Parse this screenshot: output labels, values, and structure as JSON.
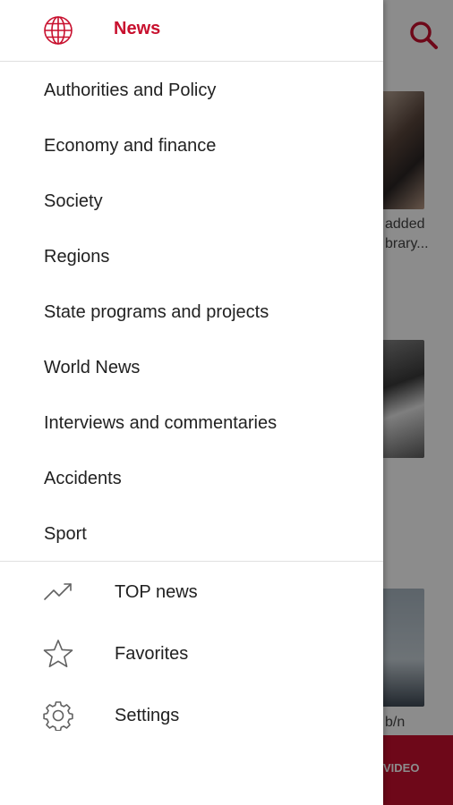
{
  "background": {
    "caption_line1": "added",
    "caption_line2": "brary...",
    "caption_line3": "b/n",
    "video_label": "VIDEO"
  },
  "drawer": {
    "title": "News",
    "categories": [
      "Authorities and Policy",
      "Economy and finance",
      "Society",
      "Regions",
      "State programs and projects",
      "World News",
      "Interviews and commentaries",
      "Accidents",
      "Sport"
    ],
    "bottom": {
      "top_news": "TOP news",
      "favorites": "Favorites",
      "settings": "Settings"
    }
  },
  "colors": {
    "accent": "#c8102e",
    "text": "#212121",
    "divider": "#e0e0e0"
  },
  "icons": {
    "header": "globe-icon",
    "search": "search-icon",
    "top_news": "trending-up-icon",
    "favorites": "star-icon",
    "settings": "gear-icon"
  }
}
